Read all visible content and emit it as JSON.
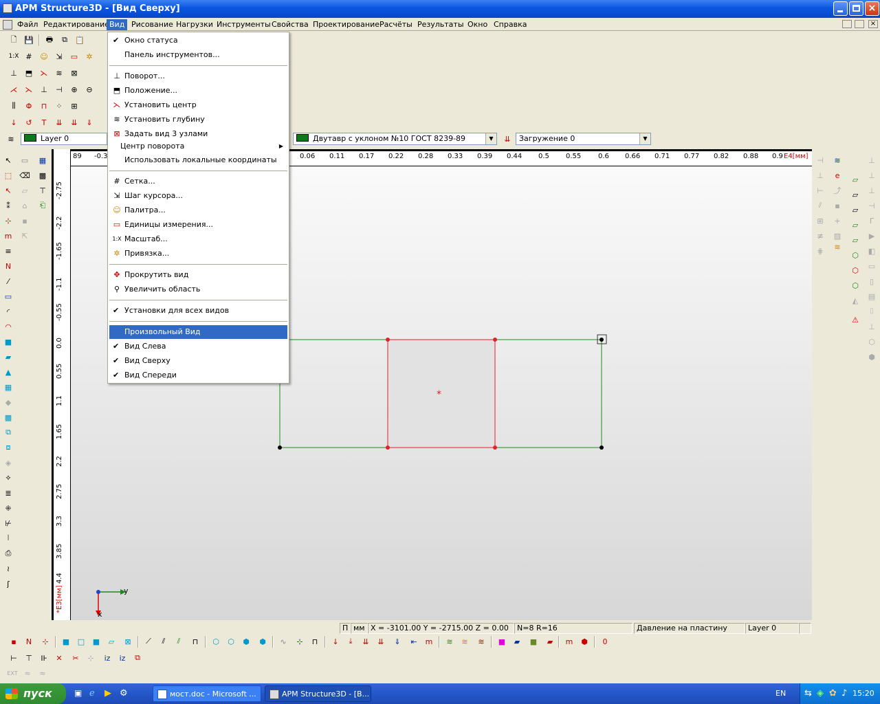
{
  "window": {
    "title": "APM Structure3D - [Вид Сверху]"
  },
  "menubar": {
    "items": [
      "Файл",
      "Редактирование",
      "Вид",
      "Рисование",
      "Нагрузки",
      "Инструменты",
      "Свойства",
      "Проектирование",
      "Расчёты",
      "Результаты",
      "Окно",
      "Справка"
    ],
    "active": "Вид"
  },
  "toolbar": {
    "layer": "Layer 0",
    "section": "Двутавр с уклоном  №10 ГОСТ 8239-89",
    "loading": "Загружение 0"
  },
  "view_menu": {
    "items": [
      {
        "label": "Окно статуса",
        "checked": true
      },
      {
        "label": "Панель инструментов..."
      },
      {
        "label": "Поворот...",
        "icon": "rotate-icon"
      },
      {
        "label": "Положение...",
        "icon": "position-icon"
      },
      {
        "label": "Установить центр",
        "icon": "set-center-icon"
      },
      {
        "label": "Установить глубину",
        "icon": "set-depth-icon"
      },
      {
        "label": "Задать вид 3 узлами",
        "icon": "three-nodes-icon"
      },
      {
        "label": "Центр поворота",
        "submenu": true
      },
      {
        "label": "Использовать локальные координаты"
      },
      {
        "label": "Сетка...",
        "icon": "grid-icon"
      },
      {
        "label": "Шаг курсора...",
        "icon": "cursor-step-icon"
      },
      {
        "label": "Палитра...",
        "icon": "palette-icon"
      },
      {
        "label": "Единицы измерения...",
        "icon": "units-icon"
      },
      {
        "label": "Масштаб...",
        "icon": "scale-icon"
      },
      {
        "label": "Привязка...",
        "icon": "snap-icon"
      },
      {
        "label": "Прокрутить вид",
        "icon": "scroll-view-icon"
      },
      {
        "label": "Увеличить область",
        "icon": "zoom-area-icon"
      },
      {
        "label": "Установки для всех видов",
        "checked": true
      },
      {
        "label": "Произвольный Вид",
        "highlighted": true
      },
      {
        "label": "Вид Слева",
        "checked": true
      },
      {
        "label": "Вид Сверху",
        "checked": true
      },
      {
        "label": "Вид Спереди",
        "checked": true
      }
    ]
  },
  "ruler": {
    "top_ticks": [
      "89",
      "-0.3",
      "0.06",
      "0.11",
      "0.17",
      "0.22",
      "0.28",
      "0.33",
      "0.39",
      "0.44",
      "0.5",
      "0.55",
      "0.6",
      "0.66",
      "0.71",
      "0.77",
      "0.82",
      "0.88",
      "0.9"
    ],
    "top_unit": "E4[мм]",
    "left_ticks": [
      "-2.75",
      "-2.2",
      "-1.65",
      "-1.1",
      "-0.55",
      "0.0",
      "0.55",
      "1.1",
      "1.65",
      "2.2",
      "2.75",
      "3.3",
      "3.85",
      "4.4"
    ],
    "left_unit": "*E3[мм]"
  },
  "axes": {
    "y": "y",
    "x": "x"
  },
  "status": {
    "mode1": "П",
    "units": "мм",
    "coords": "X = -3101.00 Y = -2715.00 Z = 0.00",
    "counts": "N=8 R=16",
    "hint": "Давление на пластину",
    "layer": "Layer 0"
  },
  "bottom_toolbar": {
    "ext": "EXT"
  },
  "taskbar": {
    "start": "пуск",
    "tasks": [
      "мост.doc - Microsoft ...",
      "APM Structure3D - [В..."
    ],
    "lang": "EN",
    "time": "15:20"
  },
  "colors": {
    "accent": "#316ac5",
    "plate_edge": "#e0202a",
    "beam": "#1a8a1a",
    "titlebar": "#0a56e0"
  }
}
